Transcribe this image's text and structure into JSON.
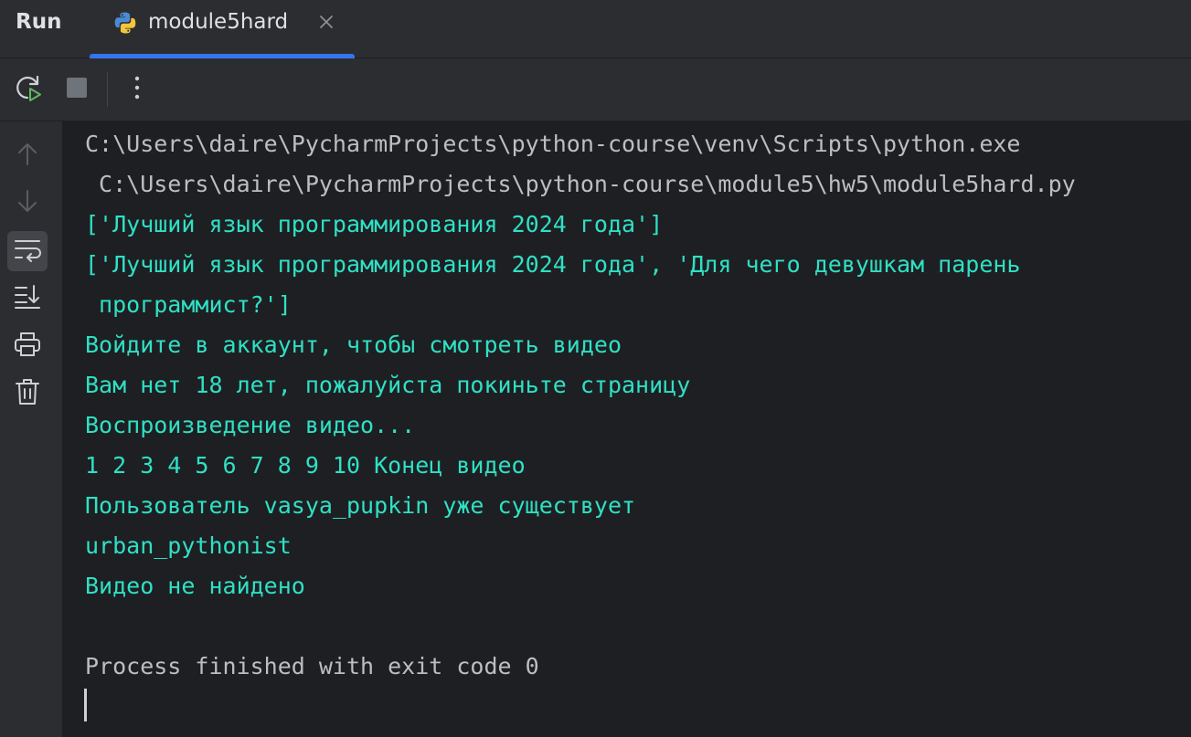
{
  "header": {
    "run_title": "Run",
    "tab_label": "module5hard",
    "accent": "#3574f0"
  },
  "toolbar": {
    "buttons": [
      {
        "icon": "rerun-icon"
      },
      {
        "icon": "stop-icon"
      },
      {
        "icon": "more-options-icon"
      }
    ]
  },
  "gutter": {
    "icons": [
      "up-arrow-icon",
      "down-arrow-icon",
      "soft-wrap-icon",
      "scroll-to-end-icon",
      "print-icon",
      "trash-icon"
    ]
  },
  "console": {
    "lines": [
      {
        "text": "C:\\Users\\daire\\PycharmProjects\\python-course\\venv\\Scripts\\python.exe",
        "color": "#bcbec4"
      },
      {
        "text": " C:\\Users\\daire\\PycharmProjects\\python-course\\module5\\hw5\\module5hard.py",
        "color": "#bcbec4"
      },
      {
        "text": "['Лучший язык программирования 2024 года']",
        "color": "#2fe0c5"
      },
      {
        "text": "['Лучший язык программирования 2024 года', 'Для чего девушкам парень",
        "color": "#2fe0c5"
      },
      {
        "text": " программист?']",
        "color": "#2fe0c5"
      },
      {
        "text": "Войдите в аккаунт, чтобы смотреть видео",
        "color": "#2fe0c5"
      },
      {
        "text": "Вам нет 18 лет, пожалуйста покиньте страницу",
        "color": "#2fe0c5"
      },
      {
        "text": "Воспроизведение видео...",
        "color": "#2fe0c5"
      },
      {
        "text": "1 2 3 4 5 6 7 8 9 10 Конец видео",
        "color": "#2fe0c5"
      },
      {
        "text": "Пользователь vasya_pupkin уже существует",
        "color": "#2fe0c5"
      },
      {
        "text": "urban_pythonist",
        "color": "#2fe0c5"
      },
      {
        "text": "Видео не найдено",
        "color": "#2fe0c5"
      },
      {
        "text": "",
        "color": "#bcbec4"
      },
      {
        "text": "Process finished with exit code 0",
        "color": "#bcbec4"
      }
    ]
  }
}
